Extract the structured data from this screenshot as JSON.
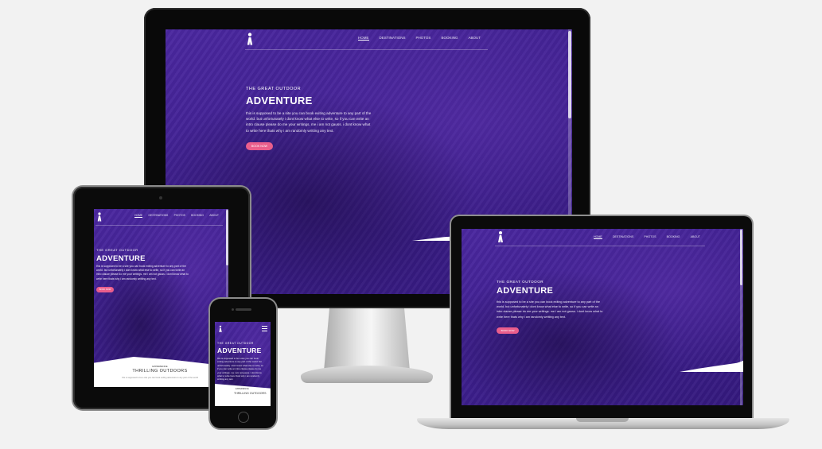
{
  "site": {
    "nav": [
      "HOME",
      "DESTINATIONS",
      "PHOTOS",
      "BOOKING",
      "ABOUT"
    ],
    "eyebrow": "THE GREAT OUTDOOR",
    "headline": "ADVENTURE",
    "paragraph": "this is supposed to be a site you can book exiting adventure to any part of the world. but unfortunately i dont know what else to write, so if you can write an intro clause please do me your writings. me i am not gauss. i dont know what to write here thats why i am randomly writting any text.",
    "cta": "BOOK NOW",
    "section_eyebrow": "EXPERIENCE",
    "section_title": "THRILLING OUTDOORS",
    "section_text": "this is supposed to be a site you can book exiting adventure to any part of the world"
  },
  "colors": {
    "accent": "#ea5e8c",
    "hero_purple": "#3d1f8e",
    "background": "#f2f2f2"
  },
  "icons": [
    "hiker-logo-icon",
    "hamburger-menu-icon"
  ]
}
